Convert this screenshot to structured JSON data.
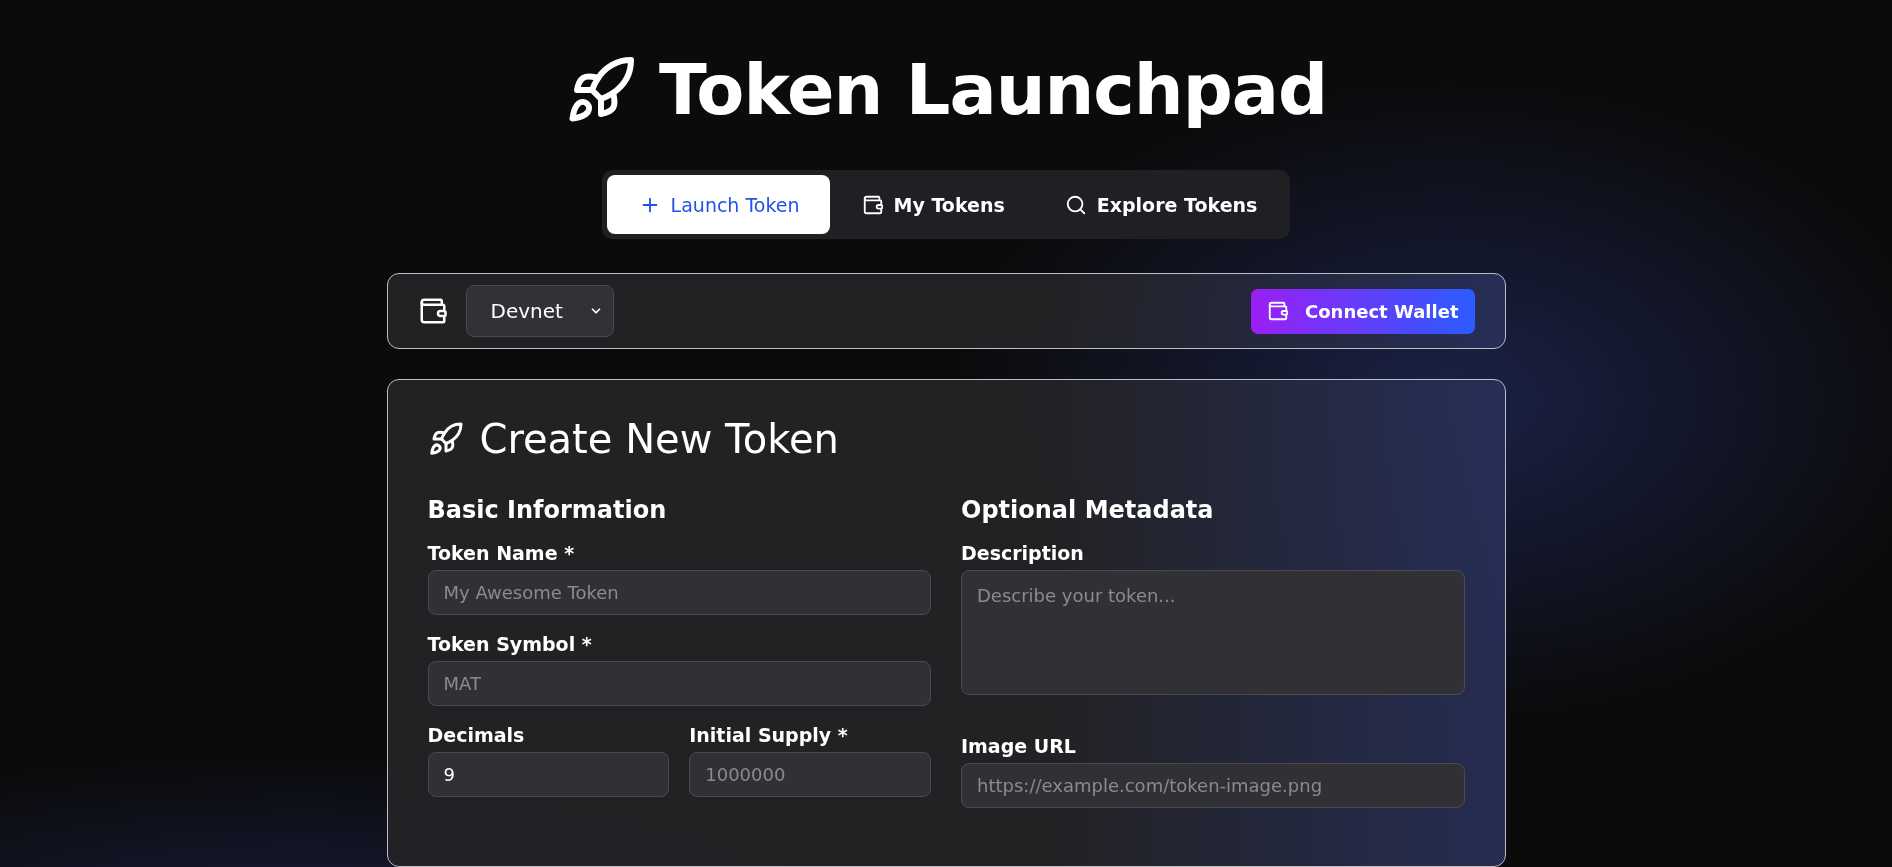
{
  "title": "Token Launchpad",
  "tabs": [
    {
      "label": "Launch Token",
      "kind": "plus",
      "selected": true
    },
    {
      "label": "My Tokens",
      "kind": "wallet",
      "selected": false
    },
    {
      "label": "Explore Tokens",
      "kind": "search",
      "selected": false
    }
  ],
  "wallet_bar": {
    "network": "Devnet",
    "connect_button": "Connect Wallet"
  },
  "form": {
    "title": "Create New Token",
    "sections": [
      {
        "heading": "Basic Information",
        "rows": [
          [
            {
              "label": "Token Name *",
              "kind": "text",
              "placeholder": "My Awesome Token"
            }
          ],
          [
            {
              "label": "Token Symbol *",
              "kind": "text",
              "placeholder": "MAT"
            }
          ],
          [
            {
              "label": "Decimals",
              "kind": "text",
              "value": "9"
            },
            {
              "label": "Initial Supply *",
              "kind": "text",
              "placeholder": "1000000"
            }
          ]
        ]
      },
      {
        "heading": "Optional Metadata",
        "rows": [
          [
            {
              "label": "Description",
              "kind": "textarea",
              "placeholder": "Describe your token..."
            }
          ],
          [
            {
              "label": "Image URL",
              "kind": "text",
              "placeholder": "https://example.com/token-image.png"
            }
          ]
        ]
      }
    ]
  }
}
